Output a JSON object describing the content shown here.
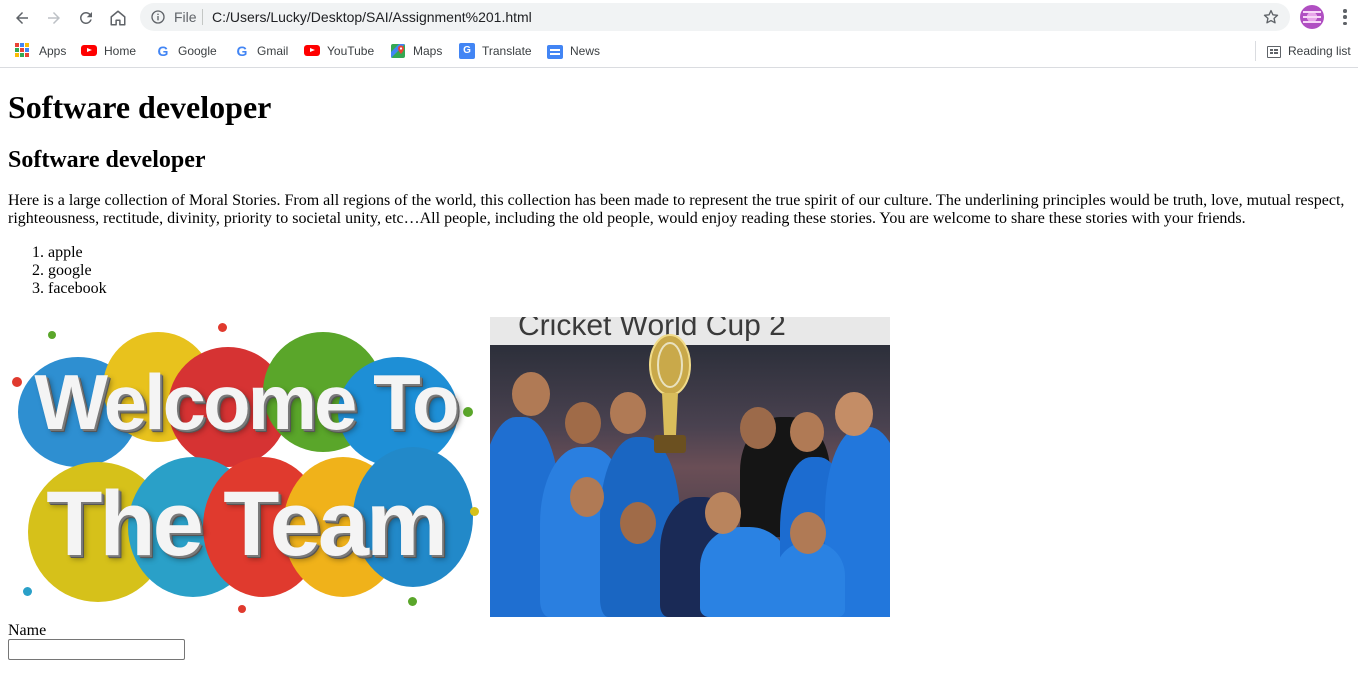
{
  "browser": {
    "file_label": "File",
    "url": "C:/Users/Lucky/Desktop/SAI/Assignment%201.html",
    "bookmarks": [
      {
        "label": "Apps",
        "icon": "apps-grid-icon"
      },
      {
        "label": "Home",
        "icon": "youtube-icon"
      },
      {
        "label": "Google",
        "icon": "google-icon"
      },
      {
        "label": "Gmail",
        "icon": "google-icon"
      },
      {
        "label": "YouTube",
        "icon": "youtube-icon"
      },
      {
        "label": "Maps",
        "icon": "maps-icon"
      },
      {
        "label": "Translate",
        "icon": "translate-icon"
      },
      {
        "label": "News",
        "icon": "news-icon"
      }
    ],
    "reading_list": "Reading list"
  },
  "page": {
    "heading1": "Software developer",
    "heading2": "Software developer",
    "paragraph": "Here is a large collection of Moral Stories. From all regions of the world, this collection has been made to represent the true spirit of our culture. The underlining principles would be truth, love, mutual respect, righteousness, rectitude, divinity, priority to societal unity, etc…All people, including the old people, would enjoy reading these stories. You are welcome to share these stories with your friends.",
    "list": [
      "apple",
      "google",
      "facebook"
    ],
    "welcome_image": {
      "line1": "Welcome To",
      "line2": "The Team"
    },
    "cricket_image": {
      "banner_text": "Cricket World Cup 2"
    },
    "form": {
      "name_label": "Name",
      "name_value": ""
    }
  }
}
